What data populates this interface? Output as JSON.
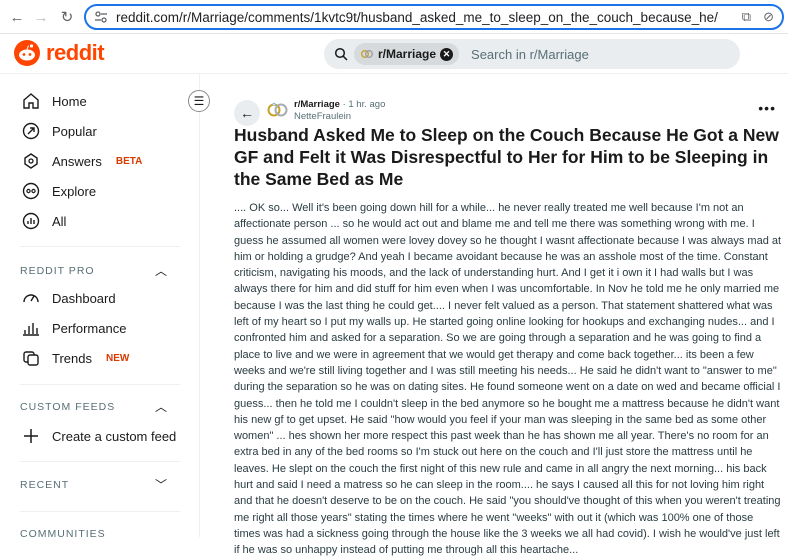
{
  "browser": {
    "url": "reddit.com/r/Marriage/comments/1kvtc9t/husband_asked_me_to_sleep_on_the_couch_because_he/"
  },
  "header": {
    "logo_text": "reddit",
    "search_chip": "r/Marriage",
    "search_placeholder": "Search in r/Marriage"
  },
  "sidebar": {
    "home": "Home",
    "popular": "Popular",
    "answers": "Answers",
    "answers_badge": "BETA",
    "explore": "Explore",
    "all": "All",
    "reddit_pro": "REDDIT PRO",
    "dashboard": "Dashboard",
    "performance": "Performance",
    "trends": "Trends",
    "trends_badge": "NEW",
    "custom_feeds": "CUSTOM FEEDS",
    "create_feed": "Create a custom feed",
    "recent": "RECENT",
    "communities": "COMMUNITIES"
  },
  "post": {
    "subreddit": "r/Marriage",
    "time": "· 1 hr. ago",
    "author": "NetteFraulein",
    "title": "Husband Asked Me to Sleep on the Couch Because He Got a New GF and Felt it Was Disrespectful to Her for Him to be Sleeping in the Same Bed as Me",
    "body": ".... OK so... Well it's been going down hill for a while... he never really treated me well because I'm not an affectionate person ... so he would act out and blame me and tell me there was something wrong with me. I guess he assumed all women were lovey dovey so he thought I wasnt affectionate because I was always mad at him or holding a grudge? And yeah I became avoidant because he was an asshole most of the time. Constant criticism, navigating his moods, and the lack of understanding hurt. And I get it i own it I had walls but I was always there for him and did stuff for him even when I was uncomfortable. In Nov he told me he only married me because I was the last thing he could get.... I never felt valued as a person. That statement shattered what was left of my heart so I put my walls up. He started going online looking for hookups and exchanging nudes... and I confronted him and asked for a separation. So we are going through a separation and he was going to find a place to live and we were in agreement that we would get therapy and come back together... its been a few weeks and we're still living together and I was still meeting his needs... He said he didn't want to \"answer to me\" during the separation so he was on dating sites. He found someone went on a date on wed and became official I guess... then he told me I couldn't sleep in the bed anymore so he bought me a mattress because he didn't want his new gf to get upset. He said \"how would you feel if your man was sleeping in the same bed as some other women\" ... hes shown her more respect this past week than he has shown me all year. There's no room for an extra bed in any of the bed rooms so I'm stuck out here on the couch and I'll just store the mattress until he leaves. He slept on the couch the first night of this new rule and came in all angry the next morning... his back hurt and said I need a matress so he can sleep in the room.... he says I caused all this for not loving him right and that he doesn't deserve to be on the couch. He said \"you should've thought of this when you weren't treating me right all those years\" stating the times where he went \"weeks\" with out it (which was 100% one of those times was had a sickness going through the house like the 3 weeks we all had covid). I wish he would've just left if he was so unhappy instead of putting me through all this heartache..."
  }
}
